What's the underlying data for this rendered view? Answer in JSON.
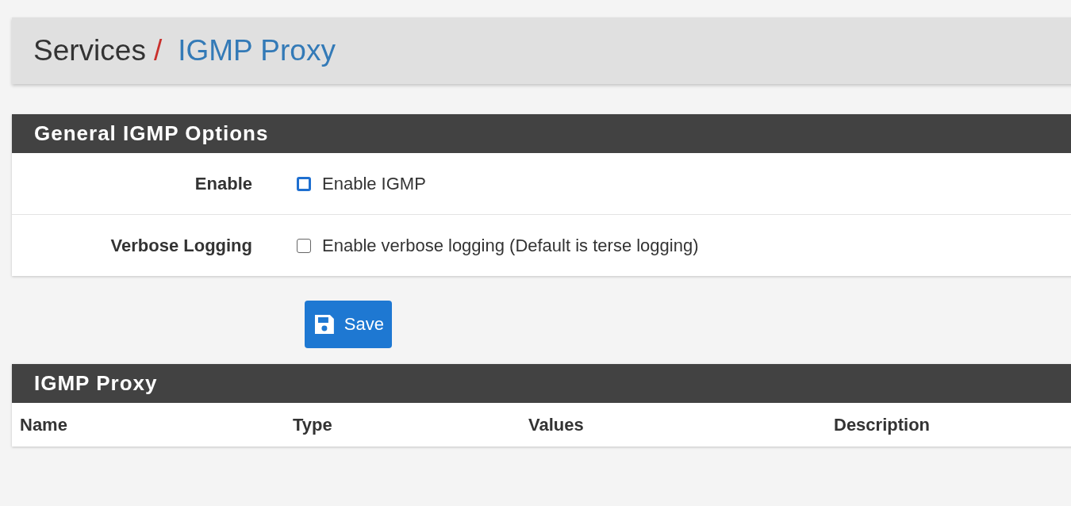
{
  "breadcrumb": {
    "section": "Services",
    "separator": "/",
    "page": "IGMP Proxy"
  },
  "general_panel": {
    "title": "General IGMP Options",
    "rows": [
      {
        "label": "Enable",
        "checkbox_label": "Enable IGMP",
        "checked": false,
        "kind": "focused"
      },
      {
        "label": "Verbose Logging",
        "checkbox_label": "Enable verbose logging (Default is terse logging)",
        "checked": false,
        "kind": "plain"
      }
    ]
  },
  "save_button": {
    "label": "Save"
  },
  "proxy_panel": {
    "title": "IGMP Proxy",
    "table": {
      "columns": [
        "Name",
        "Type",
        "Values",
        "Description"
      ]
    }
  }
}
